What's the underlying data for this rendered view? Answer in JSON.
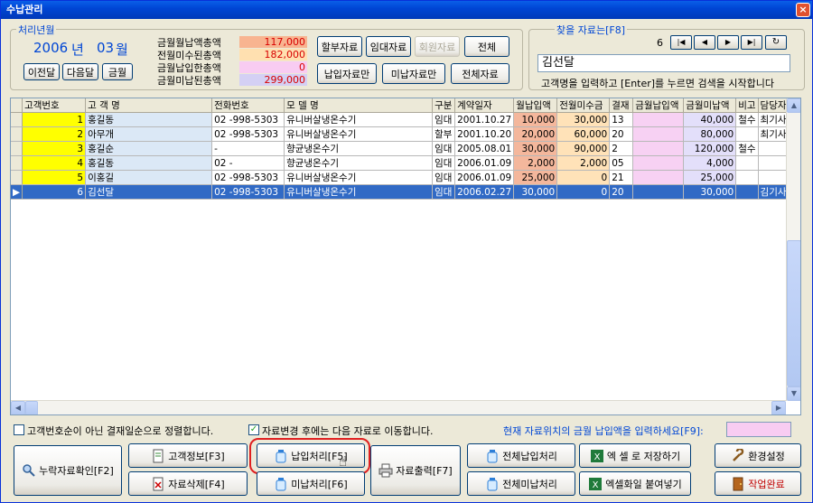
{
  "window": {
    "title": "수납관리",
    "close": "×"
  },
  "period": {
    "legend": "처리년월",
    "year": "2006",
    "year_unit": "년",
    "month": "03",
    "month_unit": "월",
    "prev": "이전달",
    "next": "다음달",
    "current": "금월"
  },
  "summary": [
    {
      "label": "금월월납액총액",
      "value": "117,000",
      "color": "#f8b490"
    },
    {
      "label": "전월미수된총액",
      "value": "182,000",
      "color": "#ffe0b0"
    },
    {
      "label": "금월납입한총액",
      "value": "0",
      "color": "#f8ccf2"
    },
    {
      "label": "금월미납된총액",
      "value": "299,000",
      "color": "#d4d0f4"
    }
  ],
  "filters": {
    "installment": "할부자료",
    "rental": "임대자료",
    "member": "회원자료",
    "all": "전체",
    "paid_only": "납입자료만",
    "unpaid_only": "미납자료만",
    "all_data": "전체자료"
  },
  "search": {
    "legend": "찾을 자료는[F8]",
    "record_no": "6",
    "value": "김선달",
    "hint": "고객명을 입력하고 [Enter]를 누르면 검색을 시작합니다"
  },
  "grid": {
    "columns": [
      "고객번호",
      "고 객 명",
      "전화번호",
      "모 델 명",
      "구분",
      "계약일자",
      "월납입액",
      "전월미수금",
      "결재",
      "금월납입액",
      "금월미납액",
      "비고",
      "담당자"
    ],
    "rows": [
      {
        "id": "1",
        "name": "홍길동",
        "phone": "02 -998-5303",
        "model": "유니버살냉온수기",
        "type": "임대",
        "date": "2001.10.27",
        "monthly": "10,000",
        "prev": "30,000",
        "pay": "13",
        "paid": "",
        "unpaid": "40,000",
        "note": "철수",
        "staff": "최기사"
      },
      {
        "id": "2",
        "name": "아무개",
        "phone": "02 -998-5303",
        "model": "유니버살냉온수기",
        "type": "할부",
        "date": "2001.10.20",
        "monthly": "20,000",
        "prev": "60,000",
        "pay": "20",
        "paid": "",
        "unpaid": "80,000",
        "note": "",
        "staff": "최기사"
      },
      {
        "id": "3",
        "name": "홍길순",
        "phone": "-",
        "model": "향균냉온수기",
        "type": "임대",
        "date": "2005.08.01",
        "monthly": "30,000",
        "prev": "90,000",
        "pay": "2",
        "paid": "",
        "unpaid": "120,000",
        "note": "철수",
        "staff": ""
      },
      {
        "id": "4",
        "name": "홍길동",
        "phone": "02 -",
        "model": "향균냉온수기",
        "type": "임대",
        "date": "2006.01.09",
        "monthly": "2,000",
        "prev": "2,000",
        "pay": "05",
        "paid": "",
        "unpaid": "4,000",
        "note": "",
        "staff": ""
      },
      {
        "id": "5",
        "name": "이홍길",
        "phone": "02 -998-5303",
        "model": "유니버살냉온수기",
        "type": "임대",
        "date": "2006.01.09",
        "monthly": "25,000",
        "prev": "0",
        "pay": "21",
        "paid": "",
        "unpaid": "25,000",
        "note": "",
        "staff": ""
      },
      {
        "id": "6",
        "name": "김선달",
        "phone": "02 -998-5303",
        "model": "유니버살냉온수기",
        "type": "임대",
        "date": "2006.02.27",
        "monthly": "30,000",
        "prev": "0",
        "pay": "20",
        "paid": "",
        "unpaid": "30,000",
        "note": "",
        "staff": "김기사"
      }
    ]
  },
  "options": {
    "sort_label": "고객번호순이 아닌 결재일순으로 정렬합니다.",
    "sort_checked": false,
    "move_label": "자료변경 후에는 다음 자료로 이동합니다.",
    "move_checked": true,
    "amount_hint": "현재 자료위치의 금월 납입액을 입력하세요[F9]:"
  },
  "actions": {
    "missing": "누락자료확인[F2]",
    "customer_info": "고객정보[F3]",
    "delete": "자료삭제[F4]",
    "pay": "납입처리[F5]",
    "unpaid": "미납처리[F6]",
    "print": "자료출력[F7]",
    "pay_all": "전체납입처리",
    "unpaid_all": "전체미납처리",
    "excel_save": "엑 셀 로 저장하기",
    "excel_paste": "엑셀화일 붙여넣기",
    "settings": "환경설정",
    "done": "작업완료"
  }
}
